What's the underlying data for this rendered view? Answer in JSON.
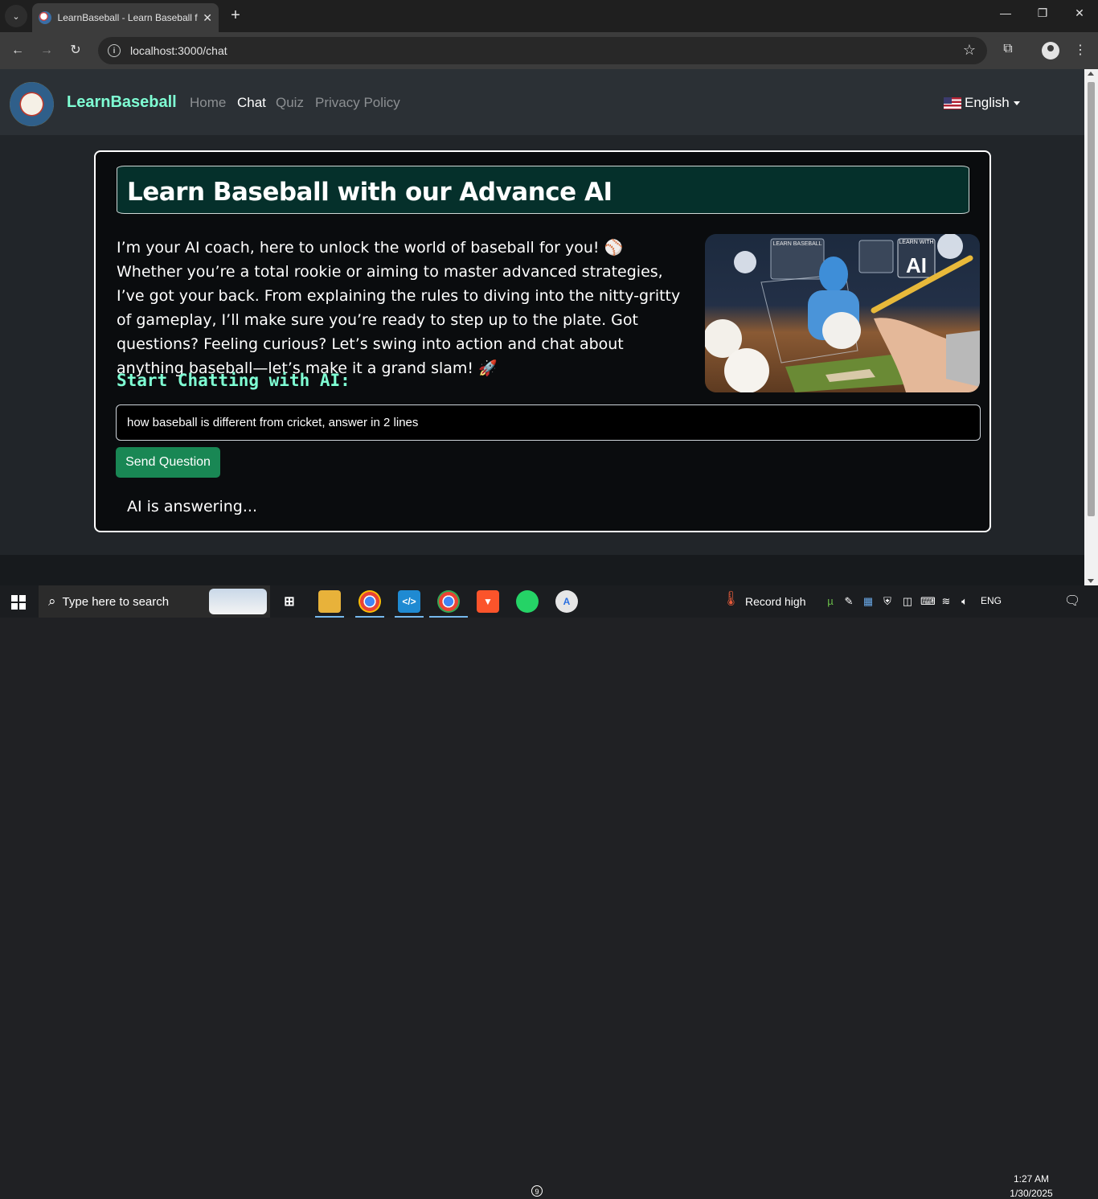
{
  "browser": {
    "tab_title": "LearnBaseball - Learn Baseball f",
    "url": "localhost:3000/chat"
  },
  "navbar": {
    "brand": "LearnBaseball",
    "links": [
      "Home",
      "Chat",
      "Quiz",
      "Privacy Policy"
    ],
    "active_link": "Chat",
    "language": "English"
  },
  "main": {
    "heading": "Learn Baseball with our Advance AI",
    "intro": "I’m your AI coach, here to unlock the world of baseball for you! ⚾ Whether you’re a total rookie or aiming to master advanced strategies, I’ve got your back. From explaining the rules to diving into the nitty-gritty of gameplay, I’ll make sure you’re ready to step up to the plate. Got questions? Feeling curious? Let’s swing into action and chat about anything baseball—let’s make it a grand slam! 🚀",
    "image_label_1": "LEARN BASEBALL",
    "image_label_2": "LEARN WITH",
    "image_label_3": "AI",
    "chat_heading": "Start Chatting with AI:",
    "question_value": "how baseball is different from cricket, answer in 2 lines",
    "send_label": "Send Question",
    "status_text": "AI is answering..."
  },
  "taskbar": {
    "search_placeholder": "Type here to search",
    "weather_text": "Record high",
    "whatsapp_badge": "9",
    "language": "ENG",
    "time": "1:27 AM",
    "date": "1/30/2025"
  },
  "colors": {
    "brand": "#7fffd4",
    "heading_bg": "#05302b",
    "send_button": "#198754",
    "navbar_bg": "#2b3035",
    "page_bg": "#212529"
  }
}
